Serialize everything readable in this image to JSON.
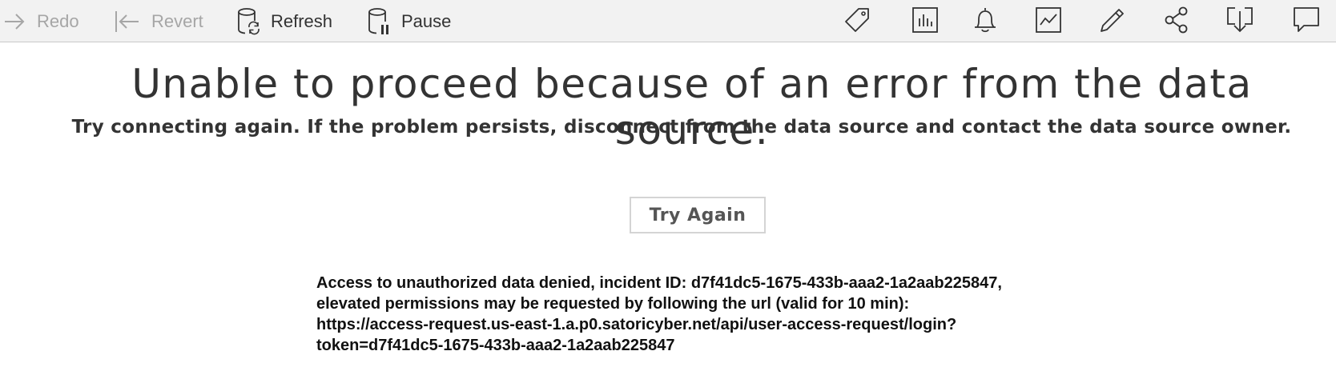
{
  "toolbar": {
    "redo_label": "Redo",
    "revert_label": "Revert",
    "refresh_label": "Refresh",
    "pause_label": "Pause",
    "icons": [
      "tag-icon",
      "chart-icon",
      "bell-icon",
      "metrics-icon",
      "pencil-icon",
      "share-icon",
      "download-icon",
      "comment-icon"
    ]
  },
  "error": {
    "title": "Unable to proceed because of an error from the data source.",
    "subtitle": "Try connecting again. If the problem persists, disconnect from the data source and contact the data source owner.",
    "button_label": "Try Again",
    "details": [
      "Access to unauthorized data denied, incident ID: d7f41dc5-1675-433b-aaa2-1a2aab225847,",
      "elevated permissions may be requested by following the url (valid for 10 min):",
      "https://access-request.us-east-1.a.p0.satoricyber.net/api/user-access-request/login?",
      "token=d7f41dc5-1675-433b-aaa2-1a2aab225847"
    ]
  },
  "colors": {
    "toolbar_bg": "#f2f2f2",
    "disabled_text": "#a6a6a6",
    "text": "#333333"
  }
}
